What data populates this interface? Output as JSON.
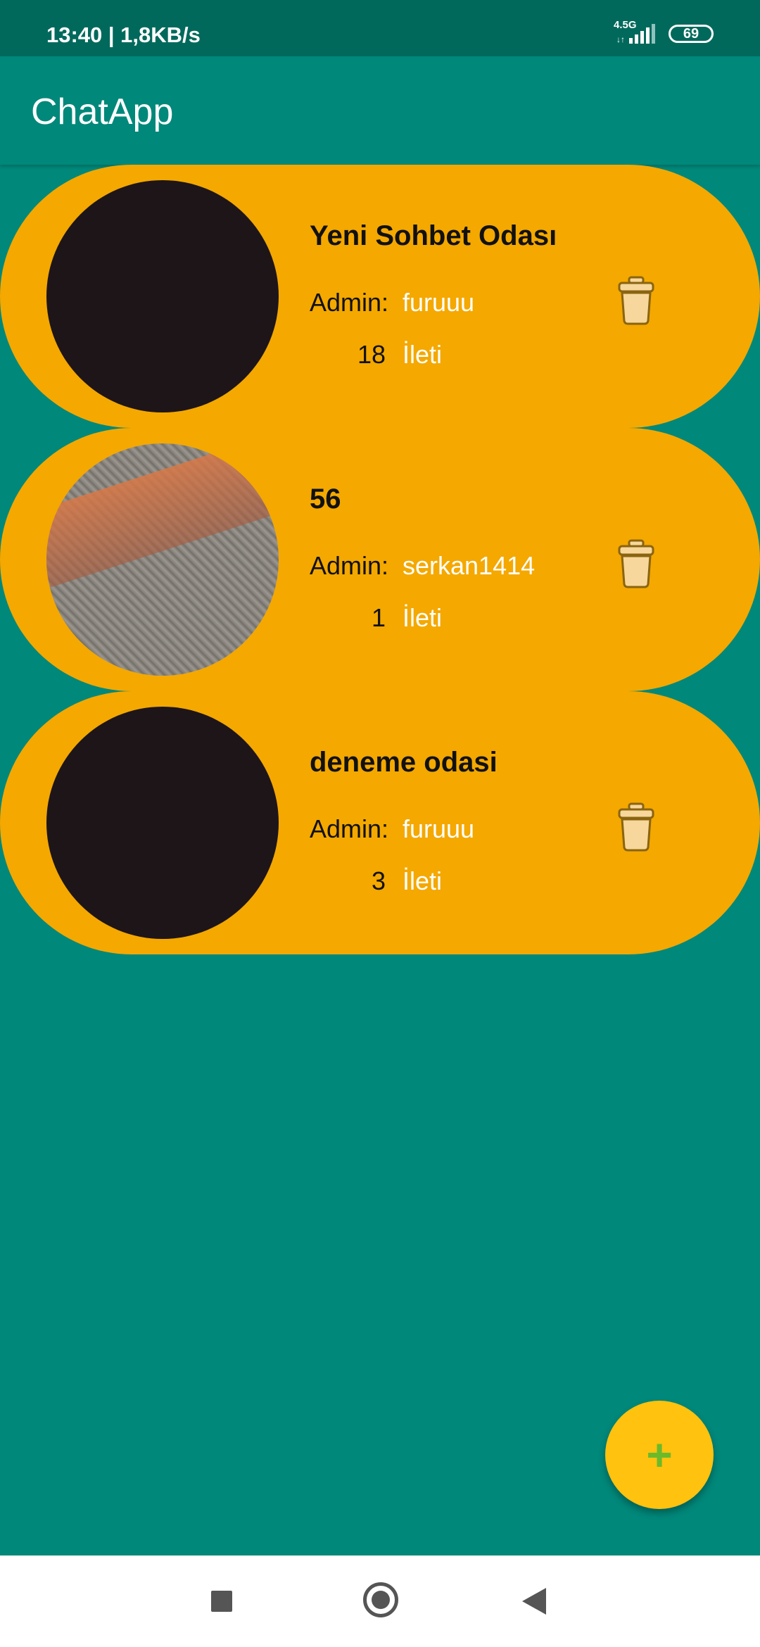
{
  "status_bar": {
    "time": "13:40 | 1,8KB/s",
    "network": "4.5G",
    "network_arrows": "↓↑",
    "battery": "69"
  },
  "app_bar": {
    "title": "ChatApp"
  },
  "rooms": [
    {
      "title": "Yeni Sohbet Odası",
      "admin_label": "Admin:",
      "admin": "furuuu",
      "message_count": "18",
      "message_label": "İleti",
      "avatar_icon": "dark-avatar"
    },
    {
      "title": "56",
      "admin_label": "Admin:",
      "admin": "serkan1414",
      "message_count": "1",
      "message_label": "İleti",
      "avatar_icon": "photo-avatar"
    },
    {
      "title": "deneme odasi",
      "admin_label": "Admin:",
      "admin": "furuuu",
      "message_count": "3",
      "message_label": "İleti",
      "avatar_icon": "dark-avatar"
    }
  ],
  "fab": {
    "label": "+"
  },
  "colors": {
    "status_bar": "#01695c",
    "background": "#00887a",
    "card": "#f4a800",
    "fab": "#ffc20e",
    "fab_icon": "#6aba2c"
  },
  "icons": {
    "delete": "trash-icon",
    "add": "plus-icon",
    "nav_recent": "square-icon",
    "nav_home": "circle-icon",
    "nav_back": "triangle-back-icon"
  }
}
